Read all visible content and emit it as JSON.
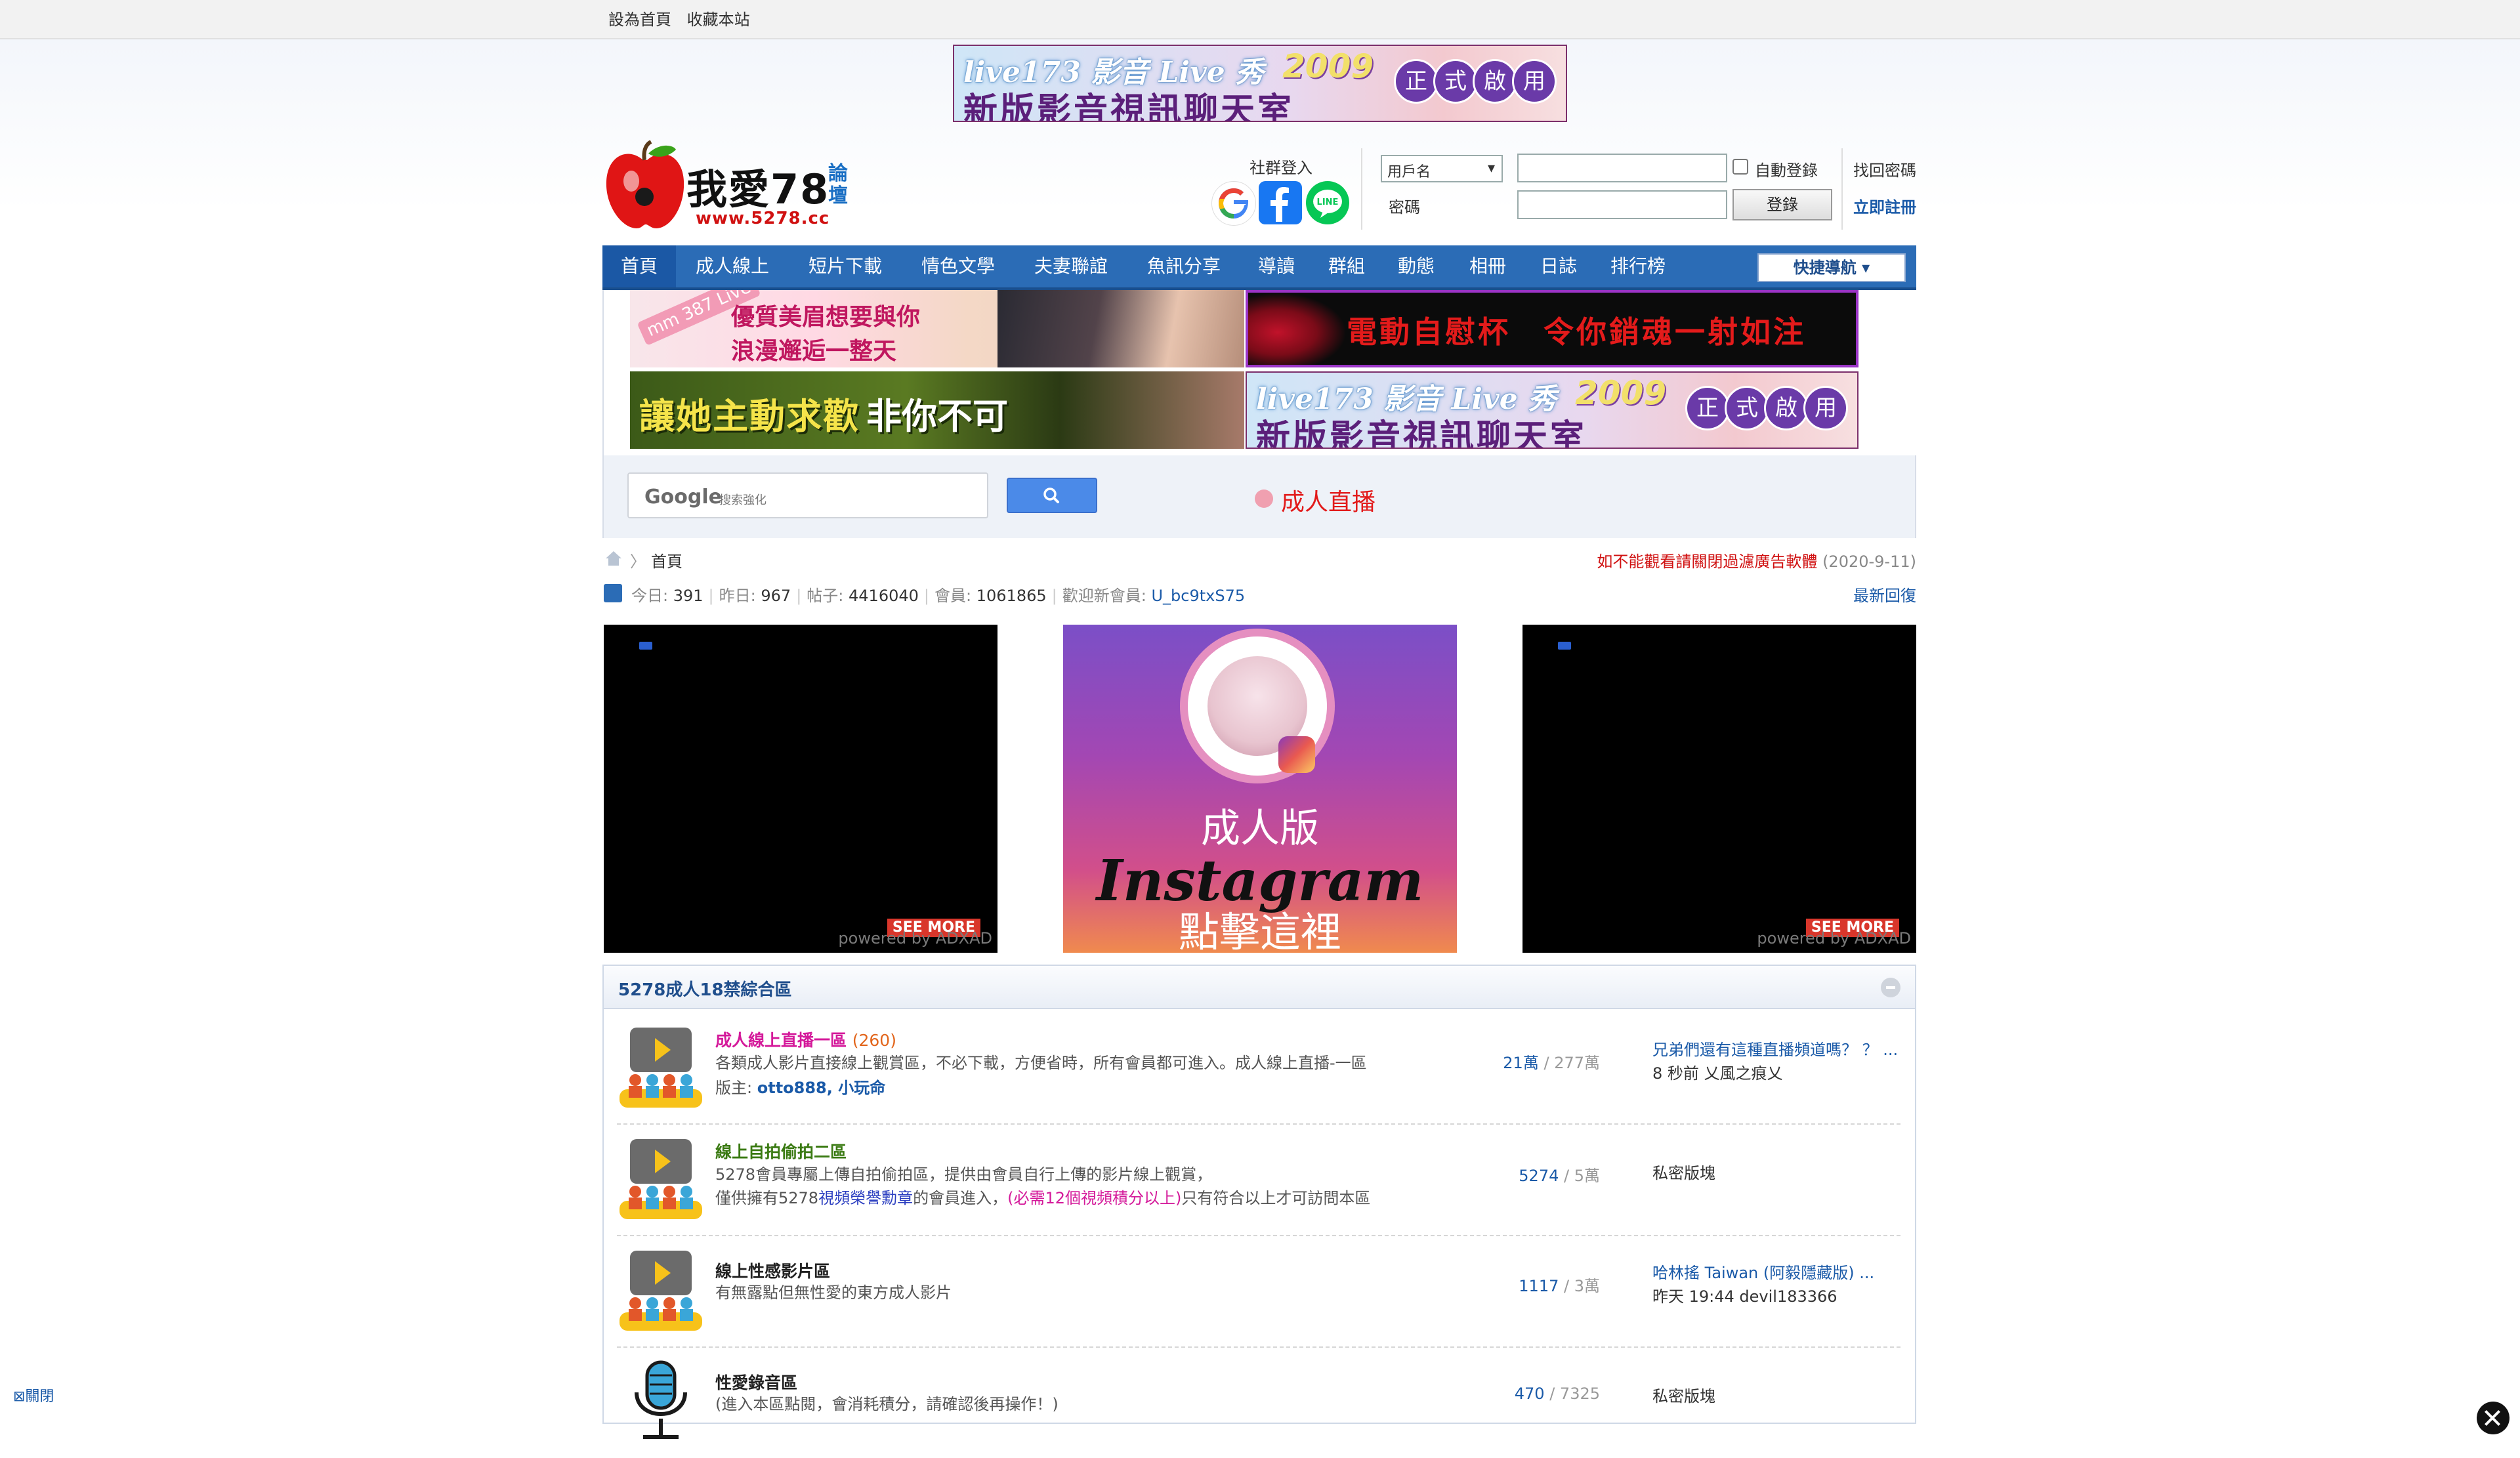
{
  "topbar": {
    "set_home": "設為首頁",
    "bookmark": "收藏本站"
  },
  "ads": {
    "top_banner": {
      "brand": "live173 影音 Live 秀",
      "year": "2009",
      "headline": "新版影音視訊聊天室",
      "badges": [
        "正",
        "式",
        "啟",
        "用"
      ]
    },
    "anime_banner": {
      "stamp": "mm 387 Live",
      "line1": "優質美眉想要與你",
      "line2": "浪漫邂逅一整天"
    },
    "cup_banner": {
      "text": "電動自慰杯　令你銷魂一射如注"
    },
    "weed_banner": {
      "text1": "讓她主動求歡",
      "text2": "非你不可"
    },
    "live_banner": {
      "brand": "live173 影音 Live 秀",
      "year": "2009",
      "headline": "新版影音視訊聊天室",
      "badges": [
        "正",
        "式",
        "啟",
        "用"
      ]
    },
    "search": {
      "google": "Google",
      "sub": "搜索強化"
    },
    "live_link": "成人直播",
    "tiles": {
      "powered": "powered by ADXAD",
      "see_more": "SEE MORE"
    },
    "instagram": {
      "top": "成人版",
      "middle": "Instagram",
      "bottom": "點擊這裡"
    },
    "close": "⊠關閉"
  },
  "header": {
    "logo_text": "我愛78",
    "logo_side": "論壇",
    "logo_url": "www.5278.cc",
    "social_label": "社群登入",
    "social_icons": [
      "google-icon",
      "facebook-icon",
      "line-icon"
    ],
    "login": {
      "username_select": "用戶名",
      "password_label": "密碼",
      "auto_login": "自動登錄",
      "login_button": "登錄",
      "find_password": "找回密碼",
      "register": "立即註冊"
    }
  },
  "nav": {
    "items": [
      "首頁",
      "成人線上",
      "短片下載",
      "情色文學",
      "夫妻聯誼",
      "魚訊分享",
      "導讀",
      "群組",
      "動態",
      "相冊",
      "日誌",
      "排行榜"
    ],
    "active_index": 0,
    "quick_nav": "快捷導航"
  },
  "breadcrumb": {
    "home": "首頁"
  },
  "notice": {
    "text": "如不能觀看請關閉過濾廣告軟體",
    "date": "(2020-9-11)"
  },
  "stats": {
    "today_label": "今日:",
    "today": "391",
    "yesterday_label": "昨日:",
    "yesterday": "967",
    "posts_label": "帖子:",
    "posts": "4416040",
    "members_label": "會員:",
    "members": "1061865",
    "welcome_label": "歡迎新會員:",
    "newest_member": "U_bc9txS75",
    "latest_replies": "最新回復"
  },
  "category": {
    "title": "5278成人18禁綜合區",
    "forums": [
      {
        "name": "成人線上直播一區",
        "count": "(260)",
        "name_color": "#d4199a",
        "desc": "各類成人影片直接線上觀賞區，不必下載，方便省時，所有會員都可進入。成人線上直播-一區",
        "mods_label": "版主:",
        "mods": "otto888, 小玩命",
        "today_posts": "21萬",
        "total_posts": "277萬",
        "last_title": "兄弟們還有這種直播頻道嗎？ ？ ...",
        "last_meta": "8 秒前 乂風之痕乂"
      },
      {
        "name": "線上自拍偷拍二區",
        "name_color": "#3a7a12",
        "desc_line1": "5278會員專屬上傳自拍偷拍區，提供由會員自行上傳的影片線上觀賞，",
        "desc_line2_a": "僅供擁有5278",
        "desc_line2_b": "視頻榮譽勳章",
        "desc_line2_c": "的會員進入，",
        "desc_line2_d": "(必需12個視頻積分以上)",
        "desc_line2_e": "只有符合以上才可訪問本區",
        "today_posts": "5274",
        "total_posts": "5萬",
        "last_title": "私密版塊"
      },
      {
        "name": "線上性感影片區",
        "name_color": "#222222",
        "desc": "有無露點但無性愛的東方成人影片",
        "today_posts": "1117",
        "total_posts": "3萬",
        "last_title": "哈林搖 Taiwan (阿毅隱藏版) ...",
        "last_meta": "昨天 19:44 devil183366"
      },
      {
        "name": "性愛錄音區",
        "name_color": "#222222",
        "desc": "(進入本區點閱，會消耗積分，請確認後再操作！)",
        "today_posts": "470",
        "total_posts": "7325",
        "last_title": "私密版塊"
      }
    ]
  },
  "colors": {
    "nav_bg": "#2b6cb6",
    "link": "#1a5aa8",
    "alert": "#d01111"
  }
}
